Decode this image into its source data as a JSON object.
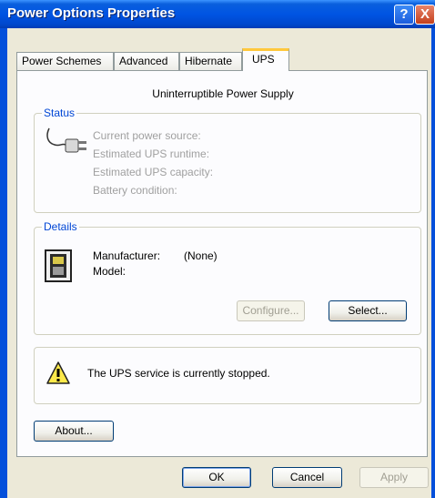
{
  "window": {
    "title": "Power Options Properties",
    "help_glyph": "?",
    "close_glyph": "X"
  },
  "tabs": [
    {
      "label": "Power Schemes",
      "active": false
    },
    {
      "label": "Advanced",
      "active": false
    },
    {
      "label": "Hibernate",
      "active": false
    },
    {
      "label": "UPS",
      "active": true
    }
  ],
  "ups": {
    "heading": "Uninterruptible Power Supply",
    "status": {
      "group_label": "Status",
      "fields": [
        "Current power source:",
        "Estimated UPS runtime:",
        "Estimated UPS capacity:",
        "Battery condition:"
      ]
    },
    "details": {
      "group_label": "Details",
      "manufacturer_label": "Manufacturer:",
      "manufacturer_value": "(None)",
      "model_label": "Model:",
      "configure_button": "Configure...",
      "select_button": "Select..."
    },
    "service_message": "The UPS service is currently stopped.",
    "about_button": "About..."
  },
  "footer": {
    "ok": "OK",
    "cancel": "Cancel",
    "apply": "Apply"
  },
  "icons": {
    "plug": "power-plug-icon",
    "ups": "ups-device-icon",
    "warning": "warning-icon"
  },
  "colors": {
    "accent": "#0046d5",
    "tab_highlight": "#ffc83c",
    "titlebar": "#0054e3",
    "close": "#d84a27"
  }
}
